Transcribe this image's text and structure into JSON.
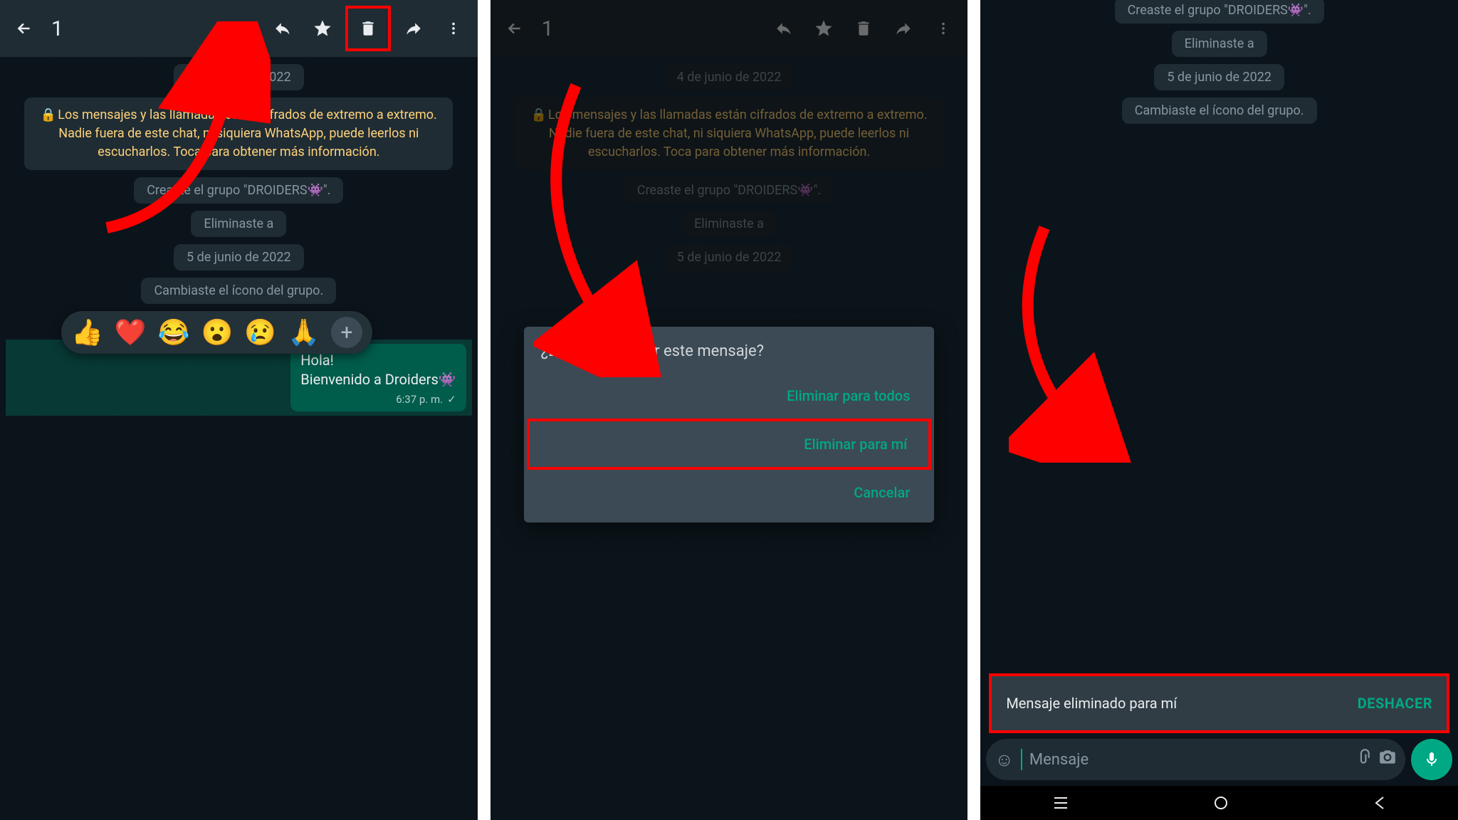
{
  "screen1": {
    "selected_count": "1",
    "date1": "4 de junio de 2022",
    "encryption": "Los mensajes y las llamadas están cifrados de extremo a extremo. Nadie fuera de este chat, ni siquiera WhatsApp, puede leerlos ni escucharlos. Toca para obtener más información.",
    "created_group": "Creaste el grupo \"DROIDERS👾\".",
    "removed": "Eliminaste a",
    "date2": "5 de junio de 2022",
    "icon_changed": "Cambiaste el ícono del grupo.",
    "msg_line1": "Hola!",
    "msg_line2": "Bienvenido a Droiders👾",
    "msg_time": "6:37 p. m.",
    "reactions": [
      "👍",
      "❤️",
      "😂",
      "😮",
      "😢",
      "🙏"
    ]
  },
  "screen2": {
    "selected_count": "1",
    "date1": "4 de junio de 2022",
    "encryption": "Los mensajes y las llamadas están cifrados de extremo a extremo. Nadie fuera de este chat, ni siquiera WhatsApp, puede leerlos ni escucharlos. Toca para obtener más información.",
    "created_group": "Creaste el grupo \"DROIDERS👾\".",
    "removed": "Eliminaste a",
    "date2": "5 de junio de 2022",
    "dialog_title": "¿Deseas eliminar este mensaje?",
    "opt1": "Eliminar para todos",
    "opt2": "Eliminar para mí",
    "opt3": "Cancelar"
  },
  "screen3": {
    "created_group": "Creaste el grupo \"DROIDERS👾\".",
    "removed": "Eliminaste a",
    "date2": "5 de junio de 2022",
    "icon_changed": "Cambiaste el ícono del grupo.",
    "snackbar_text": "Mensaje eliminado para mí",
    "undo": "DESHACER",
    "placeholder": "Mensaje"
  }
}
